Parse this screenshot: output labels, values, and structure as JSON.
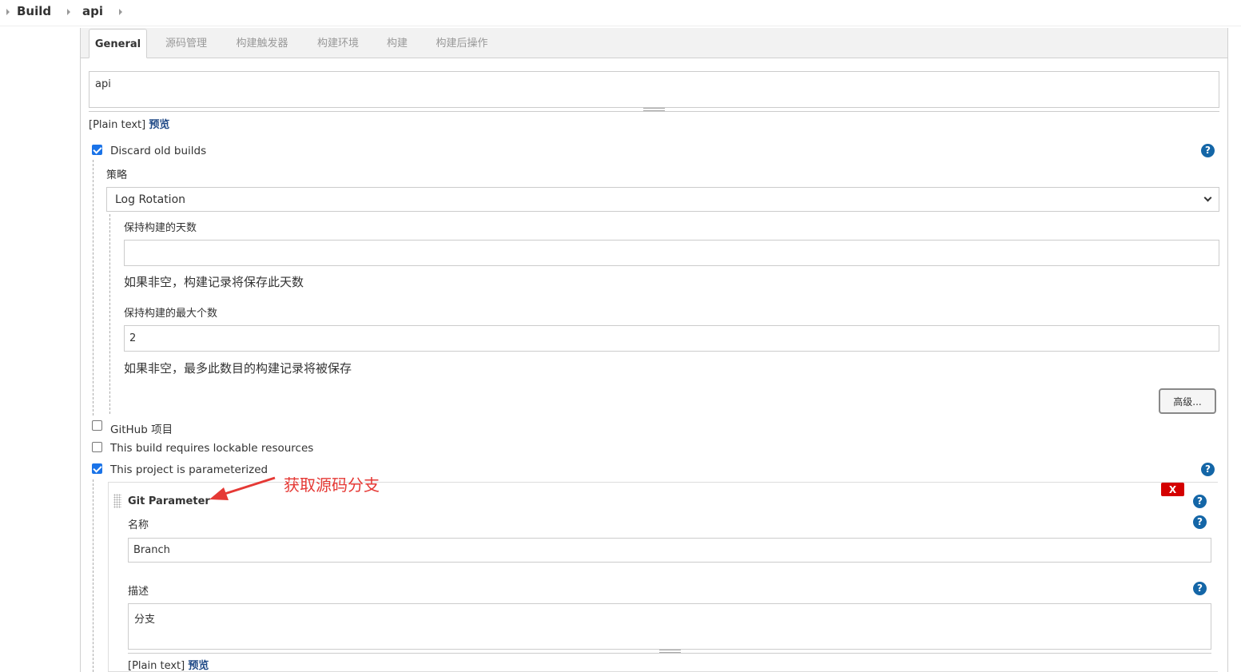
{
  "breadcrumb": {
    "items": [
      {
        "label": "Build"
      },
      {
        "label": "api"
      }
    ]
  },
  "tabs": [
    {
      "label": "General",
      "active": true
    },
    {
      "label": "源码管理"
    },
    {
      "label": "构建触发器"
    },
    {
      "label": "构建环境"
    },
    {
      "label": "构建"
    },
    {
      "label": "构建后操作"
    }
  ],
  "description": {
    "value": "api",
    "plain_text": "[Plain text]",
    "preview_link": "预览"
  },
  "discard_old_builds": {
    "label": "Discard old builds",
    "checked": true,
    "strategy_label": "策略",
    "strategy_value": "Log Rotation",
    "days_label": "保持构建的天数",
    "days_value": "",
    "days_help": "如果非空，构建记录将保存此天数",
    "max_label": "保持构建的最大个数",
    "max_value": "2",
    "max_help": "如果非空，最多此数目的构建记录将被保存",
    "advanced_button": "高级..."
  },
  "checkboxes": [
    {
      "label": "GitHub 项目",
      "checked": false
    },
    {
      "label": "This build requires lockable resources",
      "checked": false
    },
    {
      "label": "This project is parameterized",
      "checked": true
    }
  ],
  "git_parameter": {
    "title": "Git Parameter",
    "delete_label": "X",
    "name_label": "名称",
    "name_value": "Branch",
    "desc_label": "描述",
    "desc_value": "分支",
    "plain_text": "[Plain text]",
    "preview_link": "预览"
  },
  "annotation": {
    "text": "获取源码分支",
    "color": "#e53935"
  },
  "help_icon_glyph": "?",
  "colors": {
    "help_icon": "#1466a7",
    "checkbox_checked": "#1a73e8",
    "delete_button": "#d40000",
    "link": "#204a87"
  }
}
